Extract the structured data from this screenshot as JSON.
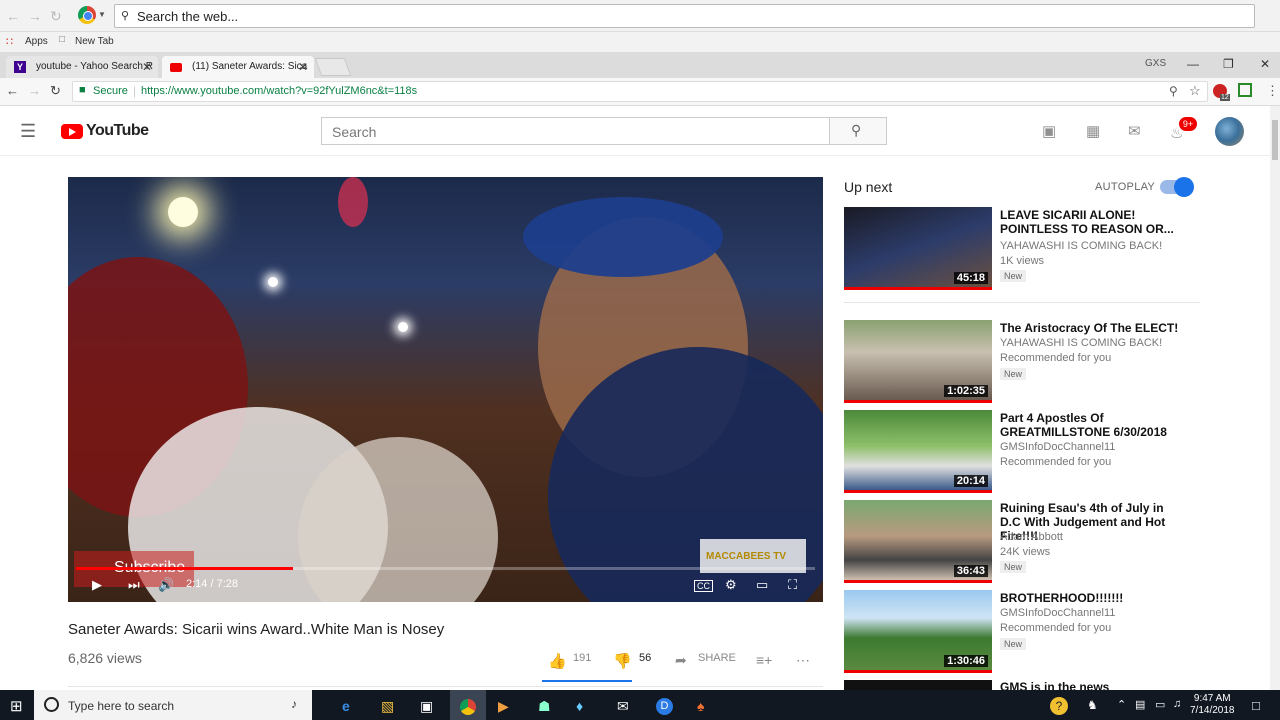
{
  "topbar": {
    "search_placeholder": "Search the web..."
  },
  "bookmarks": {
    "apps": "Apps",
    "new_tab": "New Tab"
  },
  "tabs": [
    {
      "label": "youtube - Yahoo Search R",
      "active": false
    },
    {
      "label": "(11) Saneter Awards: Sica",
      "active": true
    }
  ],
  "window": {
    "profile": "GXS"
  },
  "address": {
    "secure_label": "Secure",
    "url": "https://www.youtube.com/watch?v=92fYulZM6nc&t=118s",
    "ext_badge": "12"
  },
  "youtube": {
    "logo_text": "YouTube",
    "search_placeholder": "Search",
    "notification_count": "9+",
    "video": {
      "watermark_subscribe": "Subscribe",
      "watermark_channel": "MACCABEES TV",
      "time": "2:14 / 7:28",
      "progress": 0.294,
      "title": "Saneter Awards: Sicarii wins Award..White Man is Nosey",
      "views": "6,826 views",
      "likes": "191",
      "dislikes": "56",
      "share_label": "SHARE"
    },
    "sidebar": {
      "up_next": "Up next",
      "autoplay_label": "AUTOPLAY",
      "autoplay_on": true,
      "items": [
        {
          "title": "LEAVE SICARII ALONE! POINTLESS TO REASON OR...",
          "channel": "YAHAWASHI IS COMING BACK!",
          "meta": "1K views",
          "badge": "New",
          "duration": "45:18"
        },
        {
          "title": "The Aristocracy Of The ELECT!",
          "channel": "YAHAWASHI IS COMING BACK!",
          "meta": "Recommended for you",
          "badge": "New",
          "duration": "1:02:35"
        },
        {
          "title": "Part 4 Apostles Of GREATMILLSTONE 6/30/2018",
          "channel": "GMSInfoDocChannel11",
          "meta": "Recommended for you",
          "badge": "",
          "duration": "20:14"
        },
        {
          "title": "Ruining Esau's 4th of July in D.C With Judgement and Hot Fire!!!!",
          "channel": "Adam Abbott",
          "meta": "24K views",
          "badge": "New",
          "duration": "36:43"
        },
        {
          "title": "BROTHERHOOD!!!!!!!",
          "channel": "GMSInfoDocChannel11",
          "meta": "Recommended for you",
          "badge": "New",
          "duration": "1:30:46"
        },
        {
          "title": "GMS is in the news",
          "channel": "",
          "meta": "",
          "badge": "",
          "duration": ""
        }
      ]
    }
  },
  "taskbar": {
    "search_placeholder": "Type here to search",
    "time": "9:47 AM",
    "date": "7/14/2018"
  },
  "colors": {
    "yt_red": "#ff0000",
    "toggle_blue": "#1a73e8",
    "secure_green": "#0b8043"
  }
}
